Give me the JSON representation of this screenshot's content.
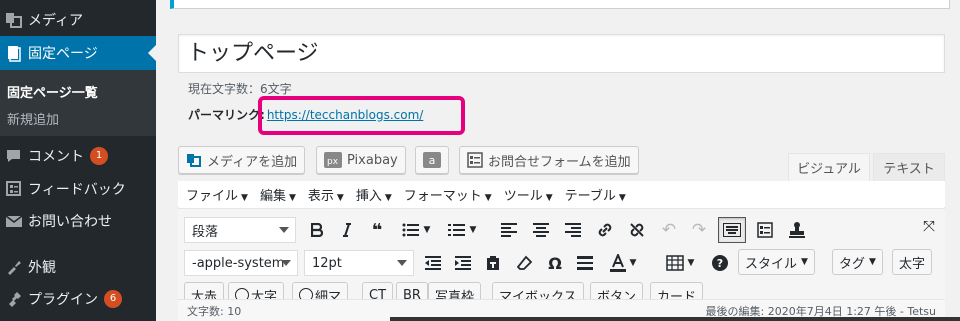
{
  "sidebar": {
    "items": [
      {
        "label": "メディア",
        "icon": "media-icon"
      },
      {
        "label": "固定ページ",
        "icon": "page-icon"
      },
      {
        "label": "コメント",
        "icon": "comment-icon",
        "badge": "1"
      },
      {
        "label": "フィードバック",
        "icon": "feedback-icon"
      },
      {
        "label": "お問い合わせ",
        "icon": "mail-icon"
      },
      {
        "label": "外観",
        "icon": "appearance-icon"
      },
      {
        "label": "プラグイン",
        "icon": "plugin-icon",
        "badge": "6"
      }
    ],
    "submenu": [
      "固定ページ一覧",
      "新規追加"
    ]
  },
  "title": {
    "value": "トップページ"
  },
  "char_count": "現在文字数：6文字",
  "permalink": {
    "label": "パーマリンク:",
    "url": "https://tecchanblogs.com/"
  },
  "media_buttons": [
    "メディアを追加",
    "Pixabay",
    "a",
    "お問合せフォームを追加"
  ],
  "tabs": {
    "visual": "ビジュアル",
    "text": "テキスト"
  },
  "menubar": [
    "ファイル",
    "編集",
    "表示",
    "挿入",
    "フォーマット",
    "ツール",
    "テーブル"
  ],
  "toolbar1": {
    "format_select": "段落"
  },
  "toolbar2": {
    "font_select": "-apple-system",
    "size_select": "12pt",
    "style_label": "スタイル",
    "tag_label": "タグ",
    "bold_label": "太字"
  },
  "toolbar3": [
    "太赤",
    "太字",
    "細マ",
    "CT",
    "BR",
    "写真枠",
    "マイボックス",
    "ボタン",
    "カード"
  ],
  "status": {
    "word_count": "文字数: 10",
    "last_edit": "最後の編集: 2020年7月4日 1:27 午後 - Tetsu"
  },
  "colors": {
    "sidebar_bg": "#23282d",
    "active": "#0073aa",
    "highlight": "#e6007e",
    "badge": "#d54e21",
    "link": "#0073aa"
  }
}
